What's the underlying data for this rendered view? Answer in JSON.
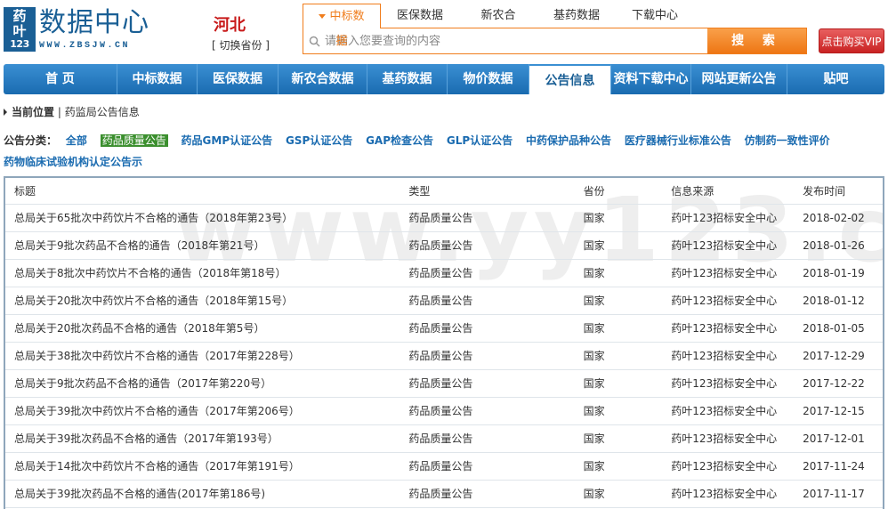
{
  "header": {
    "logo_line1": "药",
    "logo_line2": "叶",
    "logo_line3": "123",
    "site_name": "数据中心",
    "site_url": "WWW.ZBSJW.CN",
    "province": "河北",
    "switch_province": "[ 切换省份 ]",
    "top_tabs": [
      "中标数据",
      "医保数据",
      "新农合",
      "基药数据",
      "下载中心"
    ],
    "search_placeholder": "请输入您要查询的内容",
    "search_button": "搜 索",
    "vip_button": "点击购买VIP"
  },
  "main_nav": [
    "首 页",
    "中标数据",
    "医保数据",
    "新农合数据",
    "基药数据",
    "物价数据",
    "公告信息",
    "资料下载中心",
    "网站更新公告",
    "贴吧"
  ],
  "breadcrumb": {
    "current_label": "当前位置",
    "path": "| 药监局公告信息"
  },
  "categories": {
    "label": "公告分类：",
    "items": [
      "全部",
      "药品质量公告",
      "药品GMP认证公告",
      "GSP认证公告",
      "GAP检查公告",
      "GLP认证公告",
      "中药保护品种公告",
      "医疗器械行业标准公告",
      "仿制药一致性评价",
      "药物临床试验机构认定公告示"
    ],
    "selected_index": 1
  },
  "table": {
    "watermark": "www.yy123.cn",
    "headers": [
      "标题",
      "类型",
      "省份",
      "信息来源",
      "发布时间"
    ],
    "rows": [
      [
        "总局关于65批次中药饮片不合格的通告（2018年第23号）",
        "药品质量公告",
        "国家",
        "药叶123招标安全中心",
        "2018-02-02"
      ],
      [
        "总局关于9批次药品不合格的通告（2018年第21号）",
        "药品质量公告",
        "国家",
        "药叶123招标安全中心",
        "2018-01-26"
      ],
      [
        "总局关于8批次中药饮片不合格的通告（2018年第18号）",
        "药品质量公告",
        "国家",
        "药叶123招标安全中心",
        "2018-01-19"
      ],
      [
        "总局关于20批次中药饮片不合格的通告（2018年第15号）",
        "药品质量公告",
        "国家",
        "药叶123招标安全中心",
        "2018-01-12"
      ],
      [
        "总局关于20批次药品不合格的通告（2018年第5号）",
        "药品质量公告",
        "国家",
        "药叶123招标安全中心",
        "2018-01-05"
      ],
      [
        "总局关于38批次中药饮片不合格的通告（2017年第228号）",
        "药品质量公告",
        "国家",
        "药叶123招标安全中心",
        "2017-12-29"
      ],
      [
        "总局关于9批次药品不合格的通告（2017年第220号）",
        "药品质量公告",
        "国家",
        "药叶123招标安全中心",
        "2017-12-22"
      ],
      [
        "总局关于39批次中药饮片不合格的通告（2017年第206号）",
        "药品质量公告",
        "国家",
        "药叶123招标安全中心",
        "2017-12-15"
      ],
      [
        "总局关于39批次药品不合格的通告（2017年第193号）",
        "药品质量公告",
        "国家",
        "药叶123招标安全中心",
        "2017-12-01"
      ],
      [
        "总局关于14批次中药饮片不合格的通告（2017年第191号）",
        "药品质量公告",
        "国家",
        "药叶123招标安全中心",
        "2017-11-24"
      ],
      [
        "总局关于39批次药品不合格的通告(2017年第186号)",
        "药品质量公告",
        "国家",
        "药叶123招标安全中心",
        "2017-11-17"
      ]
    ]
  },
  "colors": {
    "brand_blue": "#1a5f95",
    "nav_blue": "#2a7cc2",
    "accent_orange": "#f07d1c",
    "vip_red": "#c92323",
    "province_red": "#c81a1a",
    "selected_green": "#3b8f2e",
    "link_blue": "#1a6bb0"
  }
}
